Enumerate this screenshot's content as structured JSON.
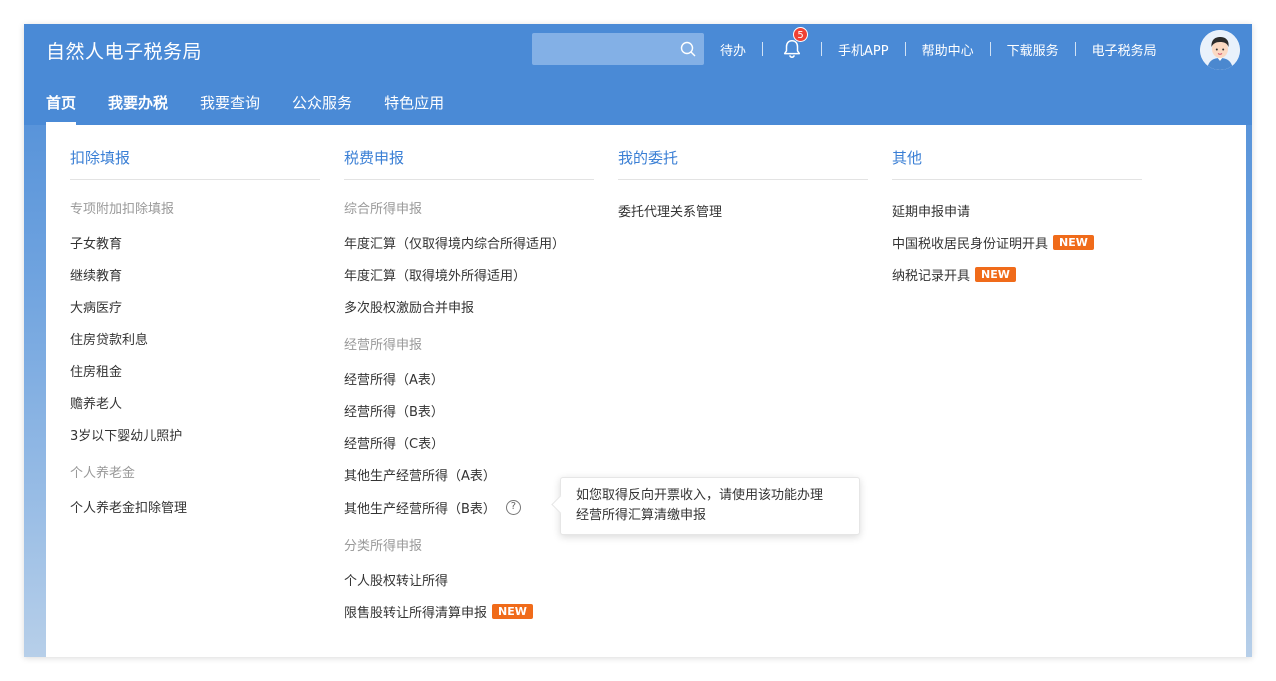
{
  "header": {
    "brand": "自然人电子税务局",
    "search_placeholder": "",
    "links": {
      "todo": "待办",
      "mobile_app": "手机APP",
      "help_center": "帮助中心",
      "download": "下载服务",
      "e_tax": "电子税务局"
    },
    "notification_count": "5"
  },
  "nav": {
    "tabs": [
      "首页",
      "我要办税",
      "我要查询",
      "公众服务",
      "特色应用"
    ]
  },
  "menu": {
    "deduction": {
      "title": "扣除填报",
      "group1": "专项附加扣除填报",
      "items1": [
        "子女教育",
        "继续教育",
        "大病医疗",
        "住房贷款利息",
        "住房租金",
        "赡养老人",
        "3岁以下婴幼儿照护"
      ],
      "group2": "个人养老金",
      "items2": [
        "个人养老金扣除管理"
      ]
    },
    "declare": {
      "title": "税费申报",
      "group1": "综合所得申报",
      "items1": [
        "年度汇算（仅取得境内综合所得适用）",
        "年度汇算（取得境外所得适用）",
        "多次股权激励合并申报"
      ],
      "group2": "经营所得申报",
      "items2": [
        "经营所得（A表）",
        "经营所得（B表）",
        "经营所得（C表）",
        "其他生产经营所得（A表）",
        "其他生产经营所得（B表）"
      ],
      "group3": "分类所得申报",
      "items3": [
        "个人股权转让所得",
        "限售股转让所得清算申报"
      ]
    },
    "entrust": {
      "title": "我的委托",
      "items": [
        "委托代理关系管理"
      ]
    },
    "other": {
      "title": "其他",
      "items": [
        "延期申报申请",
        "中国税收居民身份证明开具",
        "纳税记录开具"
      ]
    },
    "new_badge": "NEW",
    "help_mark": "?"
  },
  "tooltip": {
    "line1": "如您取得反向开票收入，请使用该功能办理",
    "line2": "经营所得汇算清缴申报"
  },
  "colors": {
    "header_bg": "#4a8ad6",
    "link_blue": "#3a7fd5",
    "new_badge": "#f06b1a",
    "notify_red": "#f04134"
  }
}
